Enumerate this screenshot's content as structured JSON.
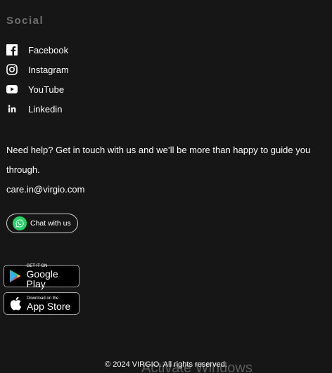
{
  "social": {
    "heading": "Social",
    "items": [
      {
        "label": "Facebook",
        "icon": "facebook-icon"
      },
      {
        "label": "Instagram",
        "icon": "instagram-icon"
      },
      {
        "label": "YouTube",
        "icon": "youtube-icon"
      },
      {
        "label": "Linkedin",
        "icon": "linkedin-icon"
      }
    ]
  },
  "help": {
    "text": "Need help? Get in touch with us and we’ll be more than happy to guide you through.",
    "email": "care.in@virgio.com",
    "chat_label": "Chat with us",
    "chat_icon": "whatsapp-icon",
    "chat_icon_color": "#25d366"
  },
  "stores": {
    "google": {
      "small": "GET IT ON",
      "big": "Google Play",
      "icon": "google-play-icon"
    },
    "apple": {
      "small": "Download on the",
      "big": "App Store",
      "icon": "apple-icon"
    }
  },
  "footer": {
    "copyright": "© 2024 VIRGIO. All rights reserved.",
    "watermark": "Activate Windows"
  },
  "colors": {
    "background": "#161616",
    "heading": "#6f6f6f",
    "text": "#ffffff"
  }
}
